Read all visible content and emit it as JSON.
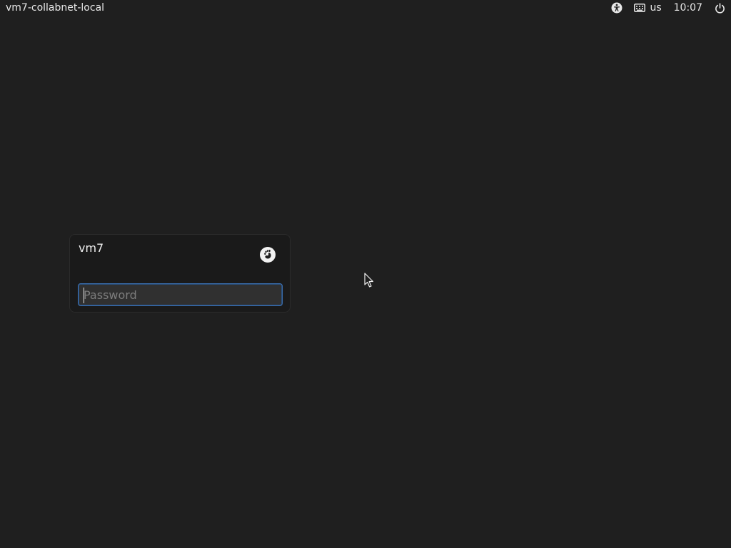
{
  "topbar": {
    "hostname": "vm7-collabnet-local",
    "keyboard_layout": "us",
    "clock": "10:07",
    "icons": {
      "accessibility": "accessibility-icon",
      "keyboard": "keyboard-icon",
      "power": "power-icon"
    }
  },
  "login": {
    "username": "vm7",
    "session_icon": "gnome-foot-icon",
    "password_placeholder": "Password",
    "password_value": ""
  },
  "colors": {
    "background": "#1f1f1f",
    "focus_border": "#3a6fb0"
  }
}
